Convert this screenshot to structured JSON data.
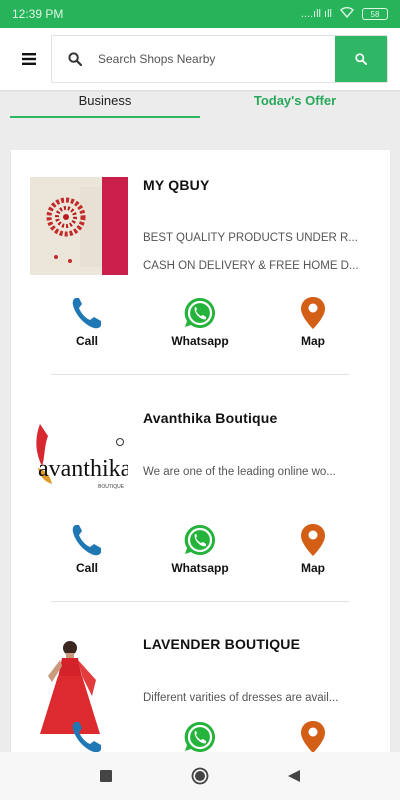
{
  "status_bar": {
    "time": "12:39 PM",
    "signal_text": "....ıll ıll",
    "battery": "58"
  },
  "header": {
    "search_placeholder": "Search Shops Nearby"
  },
  "tabs": [
    {
      "label": "Business"
    },
    {
      "label": "Today's Offer"
    }
  ],
  "shops": [
    {
      "name": "MY QBUY",
      "descriptions": [
        "BEST QUALITY PRODUCTS UNDER R...",
        "CASH ON DELIVERY & FREE HOME D..."
      ]
    },
    {
      "name": "Avanthika Boutique",
      "logo_text": "avanthika",
      "logo_sub": "BOUTIQUE",
      "descriptions": [
        "We are one of the leading online wo..."
      ]
    },
    {
      "name": "LAVENDER BOUTIQUE",
      "descriptions": [
        "Different varities of dresses are avail..."
      ]
    }
  ],
  "actions": {
    "call": "Call",
    "whatsapp": "Whatsapp",
    "map": "Map"
  },
  "colors": {
    "brand_green": "#2fb765",
    "status_green": "#27b35a",
    "call_blue": "#1f78b4",
    "whatsapp_green": "#25b33b",
    "map_orange": "#d35f17"
  }
}
